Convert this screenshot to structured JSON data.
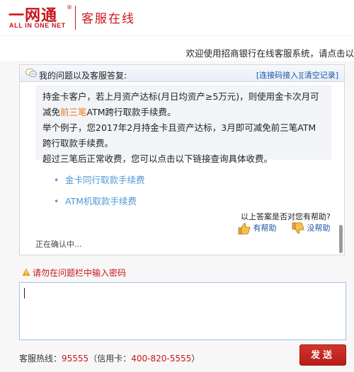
{
  "header": {
    "logo_main": "一网通",
    "logo_reg": "®",
    "logo_sub": "ALL IN ONE NET",
    "service_title": "客服在线"
  },
  "welcome": {
    "text": "欢迎使用招商银行在线客服系统，请点击以"
  },
  "chat": {
    "title": "我的问题以及客服答复:",
    "link_connect": "[连接码接入]",
    "link_clear": "[清空记录]",
    "answer": {
      "line1": "持金卡客户，若上月资产达标(月日均资产≥5万元)，则使用金卡次月可",
      "line2_pre": "减免",
      "line2_hl": "前三笔",
      "line2_post": "ATM跨行取款手续费。",
      "line3": "举个例子，您2017年2月持金卡且资产达标，3月即可减免前三笔ATM",
      "line4": "跨行取款手续费。",
      "line5": "超过三笔后正常收费，您可以点击以下链接查询具体收费。"
    },
    "links": [
      {
        "bullet": "•",
        "label": "金卡同行取款手续费"
      },
      {
        "bullet": "•",
        "label": "ATM机取款手续费"
      }
    ],
    "feedback_question": "以上答案是否对您有帮助?",
    "helpful_label": "有帮助",
    "unhelpful_label": "没帮助",
    "status": "正在确认中..."
  },
  "warning": {
    "text": "请勿在问题栏中输入密码"
  },
  "input": {
    "value": ""
  },
  "footer": {
    "hotline_label": "客服热线：",
    "hotline_number": "95555",
    "credit_label": "（信用卡：",
    "credit_number": "400-820-5555",
    "credit_close": "）",
    "send_label": "发送"
  },
  "colors": {
    "brand_red": "#c8161d",
    "link_blue": "#1a56a8",
    "highlight_orange": "#e8771e"
  }
}
